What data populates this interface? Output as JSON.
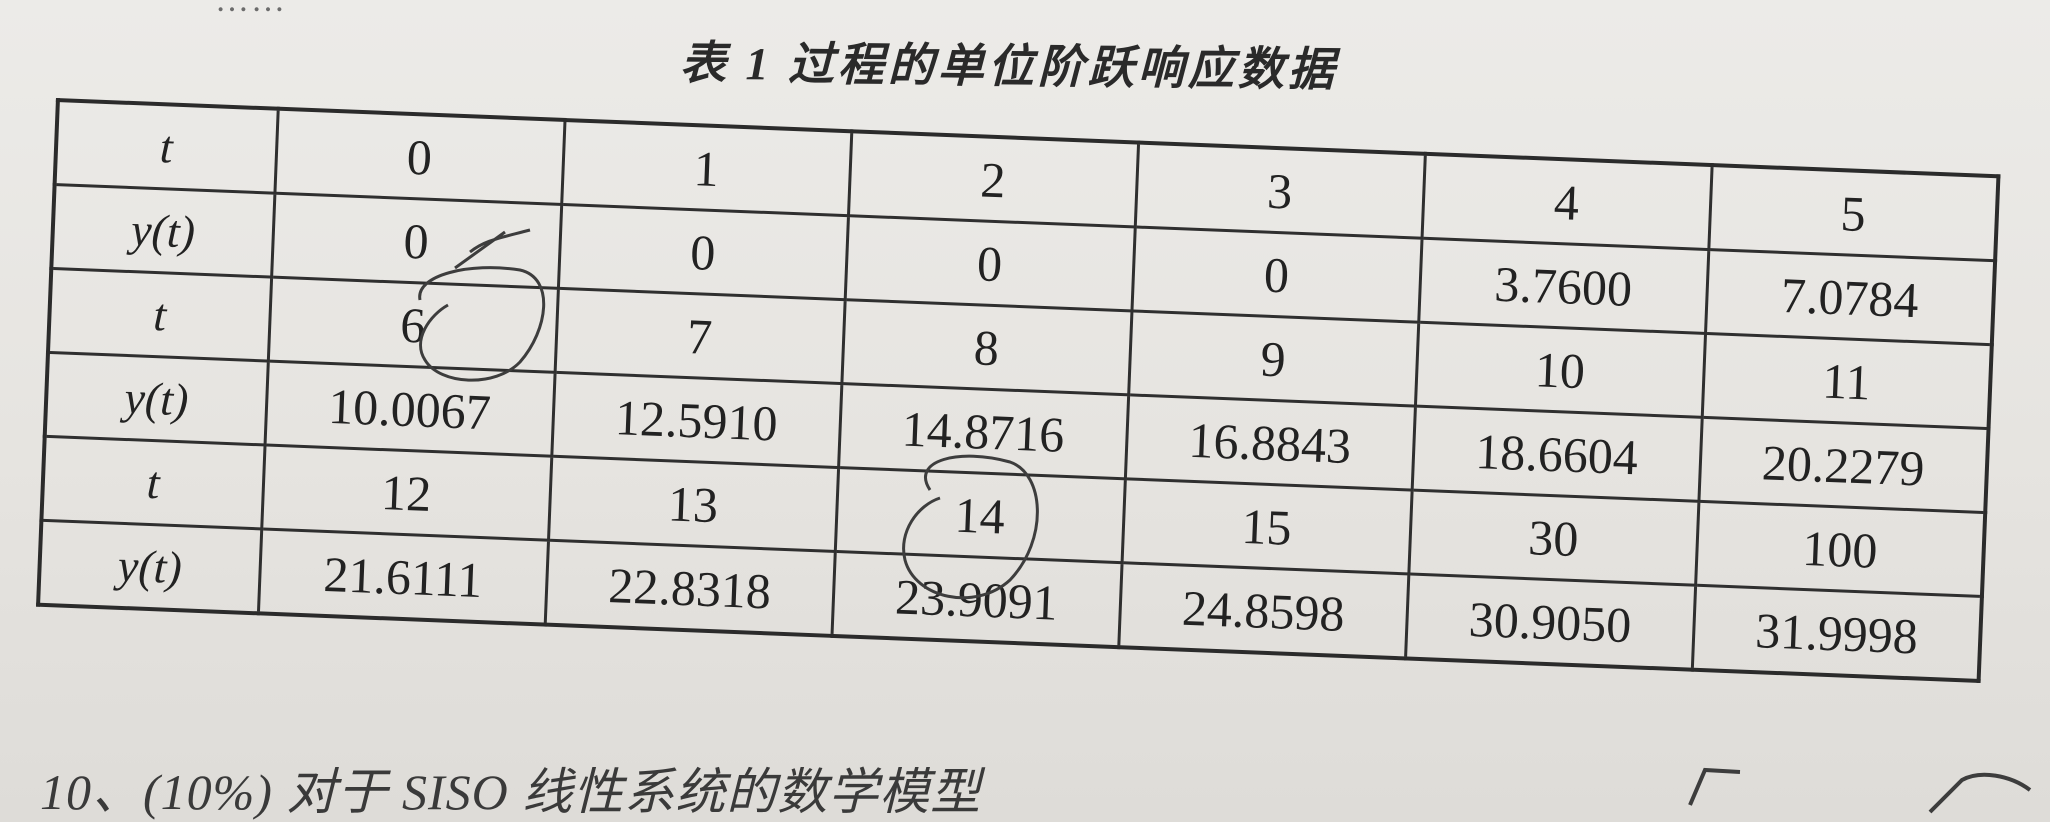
{
  "top_fragment": "……",
  "caption": "表 1 过程的单位阶跃响应数据",
  "table": {
    "rows": [
      {
        "label": "t",
        "cells": [
          "0",
          "1",
          "2",
          "3",
          "4",
          "5"
        ]
      },
      {
        "label": "y(t)",
        "cells": [
          "0",
          "0",
          "0",
          "0",
          "3.7600",
          "7.0784"
        ]
      },
      {
        "label": "t",
        "cells": [
          "6",
          "7",
          "8",
          "9",
          "10",
          "11"
        ]
      },
      {
        "label": "y(t)",
        "cells": [
          "10.0067",
          "12.5910",
          "14.8716",
          "16.8843",
          "18.6604",
          "20.2279"
        ]
      },
      {
        "label": "t",
        "cells": [
          "12",
          "13",
          "14",
          "15",
          "30",
          "100"
        ]
      },
      {
        "label": "y(t)",
        "cells": [
          "21.6111",
          "22.8318",
          "23.9091",
          "24.8598",
          "30.9050",
          "31.9998"
        ]
      }
    ]
  },
  "bottom_text": "10、(10%) 对于 SISO 线性系统的数学模型",
  "annotations": {
    "pen_color": "#3d3d3d",
    "circled_values": [
      "6",
      "14"
    ]
  }
}
